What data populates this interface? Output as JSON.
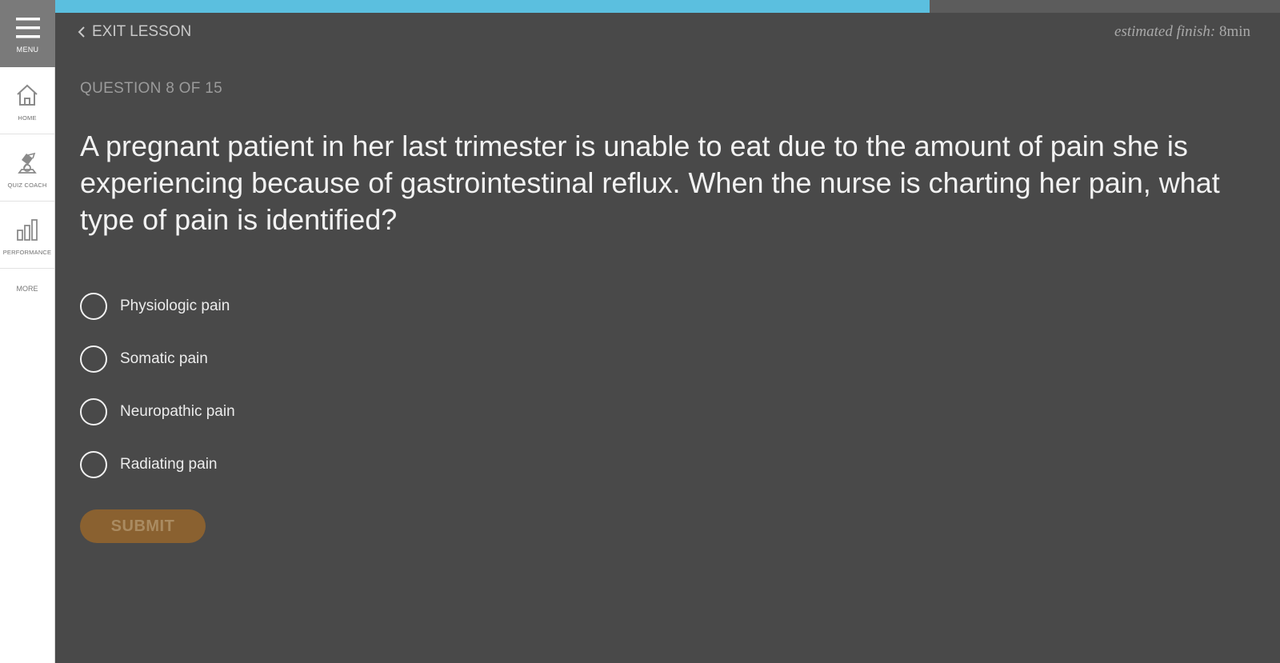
{
  "sidebar": {
    "menu_label": "MENU",
    "items": [
      {
        "label": "HOME",
        "icon": "home-icon"
      },
      {
        "label": "QUIZ COACH",
        "icon": "quiz-coach-icon"
      },
      {
        "label": "PERFORMANCE",
        "icon": "bar-chart-icon"
      }
    ],
    "more_label": "MORE"
  },
  "header": {
    "exit_label": "EXIT LESSON",
    "estimate_label": "estimated finish:",
    "estimate_value": "8min",
    "progress": 0.714
  },
  "quiz": {
    "question_count": "QUESTION 8 OF 15",
    "question": "A pregnant patient in her last trimester is unable to eat due to the amount of pain she is experiencing because of gastrointestinal reflux. When the nurse is charting her pain, what type of pain is identified?",
    "options": [
      "Physiologic pain",
      "Somatic pain",
      "Neuropathic pain",
      "Radiating pain"
    ],
    "submit_label": "SUBMIT"
  },
  "colors": {
    "progress": "#5bbfdf",
    "submit_bg": "#8a6130",
    "main_bg": "#494949"
  }
}
